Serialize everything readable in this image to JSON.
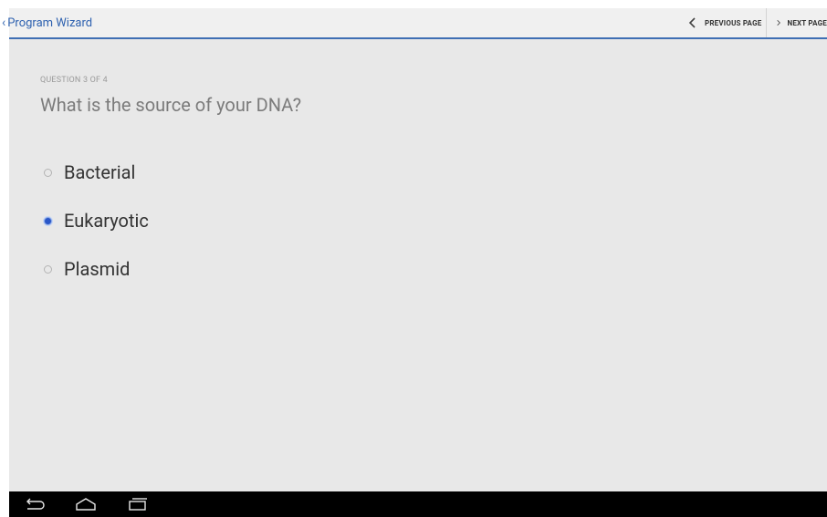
{
  "action_bar": {
    "title": "Program Wizard",
    "up_icon": "chevron-left-icon",
    "previous_page_label": "PREVIOUS PAGE",
    "next_page_label": "NEXT PAGE",
    "accent_color": "#3f6fb4"
  },
  "question": {
    "meta": "QUESTION 3 OF 4",
    "text": "What is the source of your DNA?",
    "options": [
      {
        "label": "Bacterial",
        "selected": false
      },
      {
        "label": "Eukaryotic",
        "selected": true
      },
      {
        "label": "Plasmid",
        "selected": false
      }
    ]
  },
  "system_bar": {
    "back_icon": "back-icon",
    "home_icon": "home-icon",
    "recents_icon": "recents-icon"
  }
}
